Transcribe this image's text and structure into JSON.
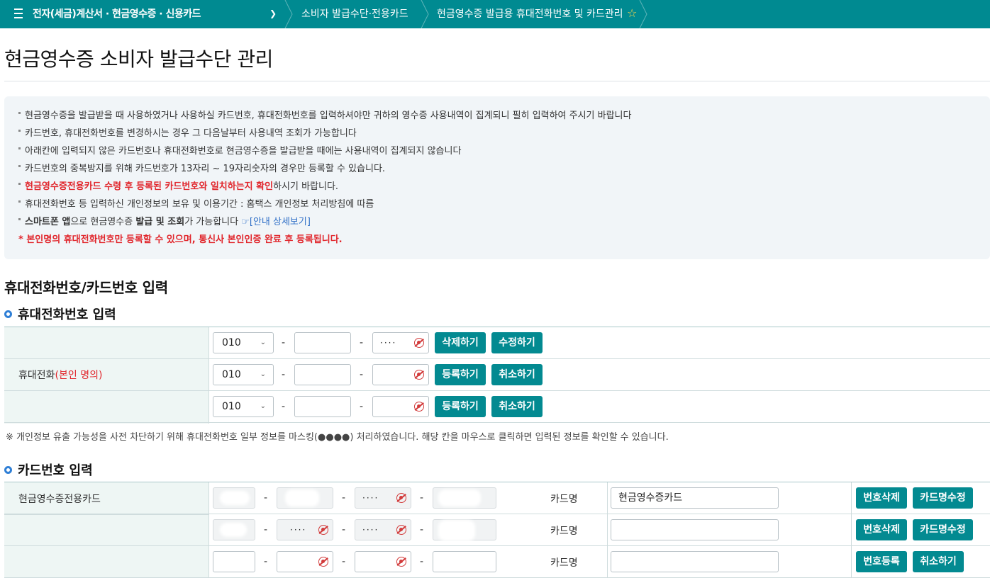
{
  "nav": {
    "crumb1": "전자(세금)계산서 · 현금영수증 · 신용카드",
    "crumb2": "소비자 발급수단·전용카드",
    "crumb3": "현금영수증 발급용 휴대전화번호 및 카드관리",
    "star_icon": "star-icon"
  },
  "page": {
    "title": "현금영수증 소비자 발급수단 관리"
  },
  "notice": {
    "items": [
      "현금영수증을 발급받을 때 사용하였거나 사용하실 카드번호, 휴대전화번호를 입력하셔야만 귀하의 영수증 사용내역이 집계되니 필히 입력하여 주시기 바랍니다",
      "카드번호, 휴대전화번호를 변경하시는 경우 그 다음날부터 사용내역 조회가 가능합니다",
      "아래칸에 입력되지 않은 카드번호나 휴대전화번호로 현금영수증을 발급받을 때에는 사용내역이 집계되지 않습니다",
      "카드번호의 중복방지를 위해 카드번호가 13자리 ~ 19자리숫자의 경우만 등록할 수 있습니다."
    ],
    "item5_red": "현금영수증전용카드 수령 후 등록된 카드번호와 일치하는지 확인",
    "item5_tail": "하시기 바랍니다.",
    "item6": "휴대전화번호 등 입력하신 개인정보의 보유 및 이용기간 : 홈택스 개인정보 처리방침에 따름",
    "item7_a": "스마트폰 앱",
    "item7_b": "으로 현금영수증 ",
    "item7_c": "발급 및 조회",
    "item7_d": "가 가능합니다 ",
    "item7_link": "☞[안내 상세보기]",
    "item8": "* 본인명의 휴대전화번호만 등록할 수 있으며, 통신사 본인인증 완료 후 등록됩니다."
  },
  "section": {
    "title": "휴대전화번호/카드번호 입력"
  },
  "phone": {
    "subtitle": "휴대전화번호 입력",
    "label": "휴대전화",
    "label_red": "(본인 명의)",
    "rows": [
      {
        "prefix": "010",
        "mid": "",
        "last": "····",
        "btn1": "삭제하기",
        "btn2": "수정하기"
      },
      {
        "prefix": "010",
        "mid": "",
        "last": "",
        "btn1": "등록하기",
        "btn2": "취소하기"
      },
      {
        "prefix": "010",
        "mid": "",
        "last": "",
        "btn1": "등록하기",
        "btn2": "취소하기"
      }
    ],
    "note": "※ 개인정보 유출 가능성을 사전 차단하기 위해 휴대전화번호 일부 정보를 마스킹(●●●●) 처리하였습니다. 해당 칸을 마우스로 클릭하면 입력된 정보를 확인할 수 있습니다."
  },
  "card": {
    "subtitle": "카드번호 입력",
    "row1_label": "현금영수증전용카드",
    "name_label": "카드명",
    "rows": [
      {
        "p2": "",
        "p3": "····",
        "name": "현금영수증카드",
        "btn1": "번호삭제",
        "btn2": "카드명수정"
      },
      {
        "p2": "····",
        "p3": "····",
        "name": "",
        "btn1": "번호삭제",
        "btn2": "카드명수정"
      },
      {
        "p2": "",
        "p3": "",
        "name": "",
        "btn1": "번호등록",
        "btn2": "취소하기"
      }
    ]
  }
}
